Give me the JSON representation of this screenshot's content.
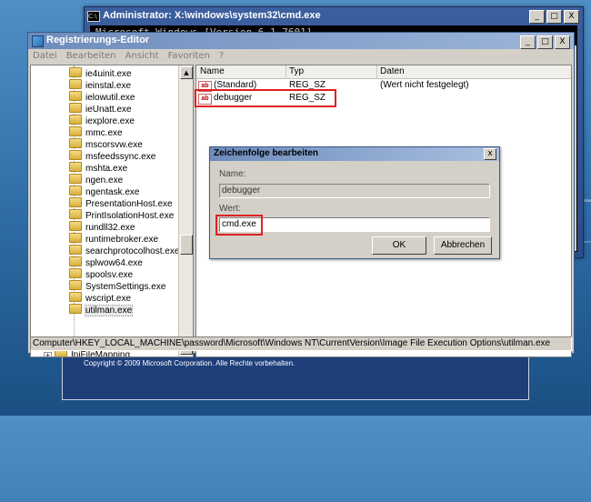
{
  "cmd_window": {
    "title": "Administrator: X:\\windows\\system32\\cmd.exe",
    "icon": "C:\\",
    "first_line": "Microsoft Windows [Version 6.1.7601]"
  },
  "regedit": {
    "title": "Registrierungs-Editor",
    "menu": [
      "Datei",
      "Bearbeiten",
      "Ansicht",
      "Favoriten",
      "?"
    ],
    "tree_items": [
      "ie4uinit.exe",
      "ieinstal.exe",
      "ielowutil.exe",
      "ieUnatt.exe",
      "iexplore.exe",
      "mmc.exe",
      "mscorsvw.exe",
      "msfeedssync.exe",
      "mshta.exe",
      "ngen.exe",
      "ngentask.exe",
      "PresentationHost.exe",
      "PrintIsolationHost.exe",
      "rundll32.exe",
      "runtimebroker.exe",
      "searchprotocolhost.exe",
      "splwow64.exe",
      "spoolsv.exe",
      "SystemSettings.exe",
      "wscript.exe",
      "utilman.exe"
    ],
    "tree_bottom_item": "IniFileMapping",
    "columns": {
      "name": "Name",
      "type": "Typ",
      "data": "Daten"
    },
    "values": [
      {
        "name": "(Standard)",
        "type": "REG_SZ",
        "data": "(Wert nicht festgelegt)"
      },
      {
        "name": "debugger",
        "type": "REG_SZ",
        "data": ""
      }
    ],
    "status_path": "Computer\\HKEY_LOCAL_MACHINE\\password\\Microsoft\\Windows NT\\CurrentVersion\\Image File Execution Options\\utilman.exe"
  },
  "dialog": {
    "title": "Zeichenfolge bearbeiten",
    "name_label": "Name:",
    "name_value": "debugger",
    "value_label": "Wert:",
    "value_value": "cmd.exe",
    "ok": "OK",
    "cancel": "Abbrechen",
    "close": "x"
  },
  "window_controls": {
    "minimize": "_",
    "maximize": "□",
    "close": "X"
  },
  "desktop": {
    "copyright": "Copyright © 2009 Microsoft Corporation. Alle Rechte vorbehalten."
  },
  "colors": {
    "highlight": "#e02020",
    "title_bar": "#6e8cbc"
  }
}
